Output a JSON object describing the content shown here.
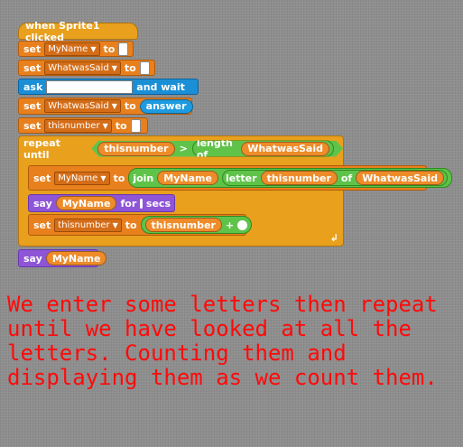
{
  "script": {
    "hat": {
      "label": "when Sprite1 clicked"
    },
    "set1": {
      "keyword": "set",
      "var": "MyName",
      "to": "to"
    },
    "set2": {
      "keyword": "set",
      "var": "WhatwasSaid",
      "to": "to"
    },
    "ask": {
      "keyword": "ask",
      "suffix": "and wait"
    },
    "set3": {
      "keyword": "set",
      "var": "WhatwasSaid",
      "to": "to",
      "value": "answer"
    },
    "set4": {
      "keyword": "set",
      "var": "thisnumber",
      "to": "to"
    },
    "repeat": {
      "keyword": "repeat until",
      "lhs": "thisnumber",
      "op": ">",
      "length_of": "length of",
      "rhs": "WhatwasSaid"
    },
    "inner_set1": {
      "keyword": "set",
      "var": "MyName",
      "to": "to",
      "join": "join",
      "join_a": "MyName",
      "letter": "letter",
      "letter_idx": "thisnumber",
      "of": "of",
      "of_var": "WhatwasSaid"
    },
    "say_for": {
      "keyword": "say",
      "value": "MyName",
      "for": "for",
      "secs": "secs"
    },
    "inner_set2": {
      "keyword": "set",
      "var": "thisnumber",
      "to": "to",
      "lhs": "thisnumber",
      "op": "+"
    },
    "say": {
      "keyword": "say",
      "value": "MyName"
    }
  },
  "description": "We enter some letters then repeat until we have looked at all the letters. Counting them and displaying them as we count them.",
  "colors": {
    "background": "#8e8e8e",
    "variables": "#e8801e",
    "sensing": "#1a8fd6",
    "looks": "#8e55d6",
    "control": "#e8a01d",
    "operators": "#5fc34a",
    "description_text": "#ff0a0a"
  }
}
